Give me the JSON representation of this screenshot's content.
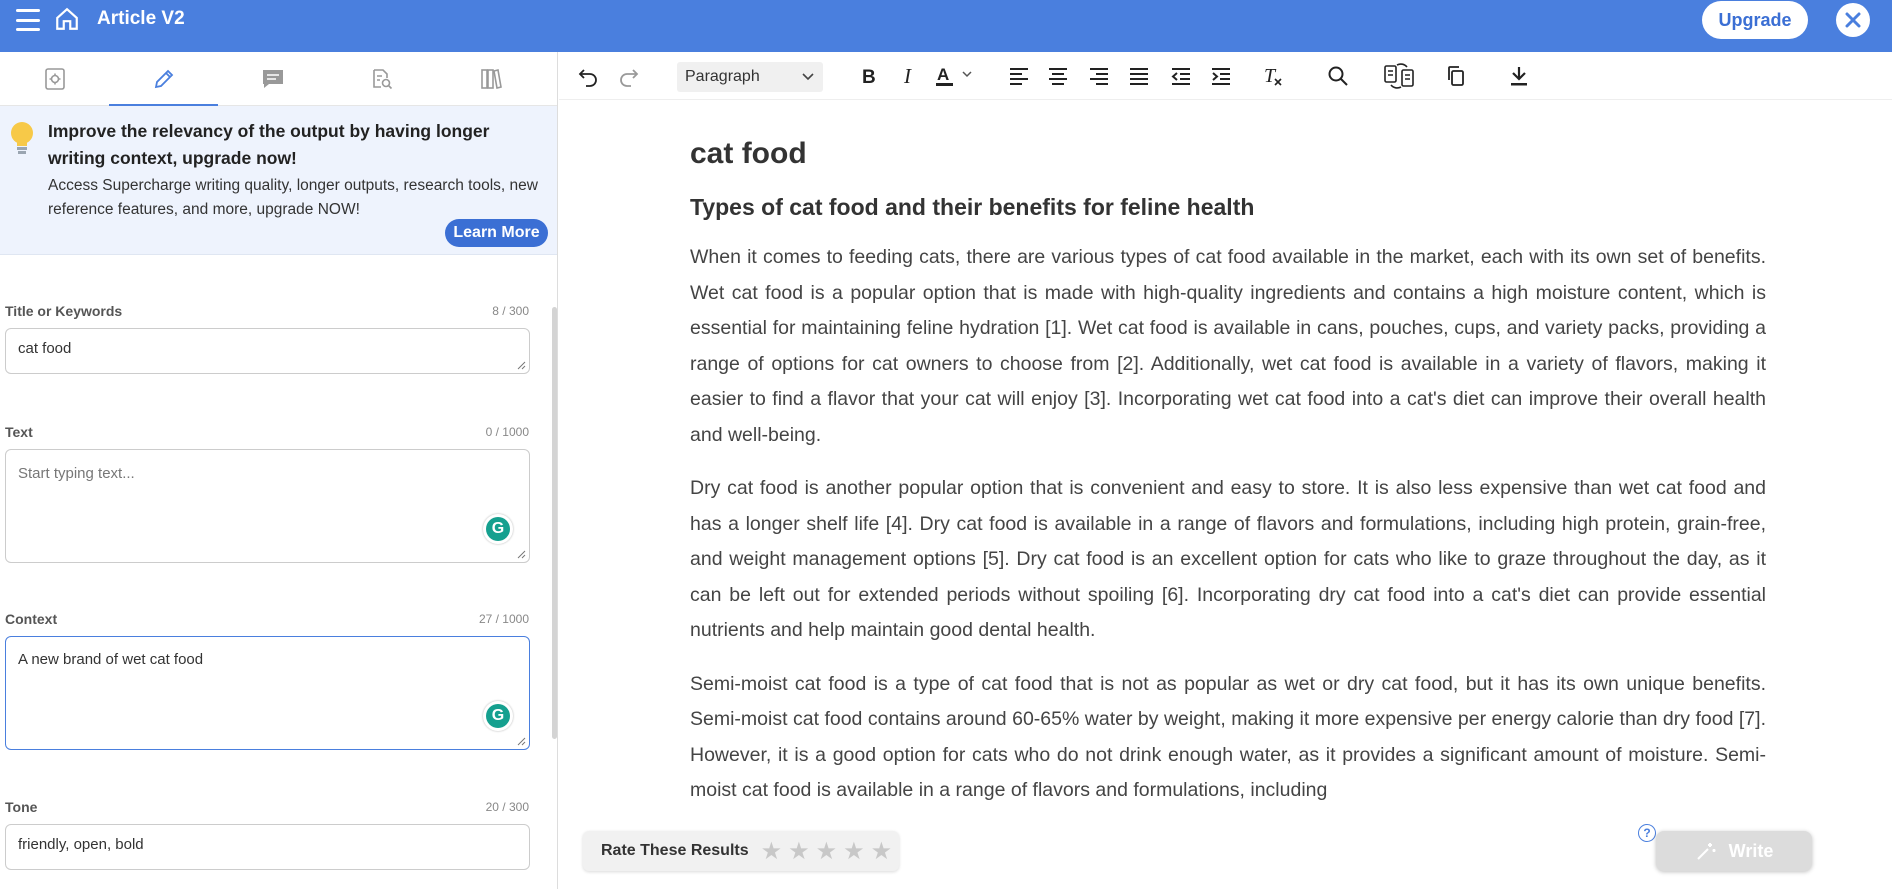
{
  "header": {
    "app_title": "Article V2",
    "upgrade_label": "Upgrade"
  },
  "left_panel": {
    "tabs": [
      {
        "name": "settings-tab",
        "icon": "gear-document-icon"
      },
      {
        "name": "write-tab",
        "icon": "pencil-icon",
        "active": true
      },
      {
        "name": "chat-tab",
        "icon": "chat-bubble-icon"
      },
      {
        "name": "research-tab",
        "icon": "search-document-icon"
      },
      {
        "name": "library-tab",
        "icon": "books-icon"
      }
    ],
    "promo": {
      "title": "Improve the relevancy of the output by having longer writing context, upgrade now!",
      "body": "Access Supercharge writing quality, longer outputs, research tools, new reference features, and more, upgrade NOW!",
      "learn_more_label": "Learn More"
    },
    "fields": {
      "title": {
        "label": "Title or Keywords",
        "count": "8 / 300",
        "value": "cat food"
      },
      "text": {
        "label": "Text",
        "count": "0 / 1000",
        "placeholder": "Start typing text..."
      },
      "context": {
        "label": "Context",
        "count": "27 / 1000",
        "value": "A new brand of wet cat food"
      },
      "tone": {
        "label": "Tone",
        "count": "20 / 300",
        "value": "friendly, open, bold"
      }
    }
  },
  "editor": {
    "toolbar": {
      "block_format": "Paragraph"
    },
    "document": {
      "title": "cat food",
      "heading": "Types of cat food and their benefits for feline health",
      "paragraphs": [
        "When it comes to feeding cats, there are various types of cat food available in the market, each with its own set of benefits. Wet cat food is a popular option that is made with high-quality ingredients and contains a high moisture content, which is essential for maintaining feline hydration [1]. Wet cat food is available in cans, pouches, cups, and variety packs, providing a range of options for cat owners to choose from [2]. Additionally, wet cat food is available in a variety of flavors, making it easier to find a flavor that your cat will enjoy [3]. Incorporating wet cat food into a cat's diet can improve their overall health and well-being.",
        "Dry cat food is another popular option that is convenient and easy to store. It is also less expensive than wet cat food and has a longer shelf life [4]. Dry cat food is available in a range of flavors and formulations, including high protein, grain-free, and weight management options [5]. Dry cat food is an excellent option for cats who like to graze throughout the day, as it can be left out for extended periods without spoiling [6]. Incorporating dry cat food into a cat's diet can provide essential nutrients and help maintain good dental health.",
        "Semi-moist cat food is a type of cat food that is not as popular as wet or dry cat food, but it has its own unique benefits. Semi-moist cat food contains around 60-65% water by weight, making it more expensive per energy calorie than dry food [7]. However, it is a good option for cats who do not drink enough water, as it provides a significant amount of moisture. Semi-moist cat food is available in a range of flavors and formulations, including"
      ]
    },
    "rating": {
      "label": "Rate These Results",
      "stars": "★★★★★"
    },
    "write_label": "Write"
  },
  "colors": {
    "brand": "#4a7fde",
    "grammarly": "#15a08f"
  }
}
